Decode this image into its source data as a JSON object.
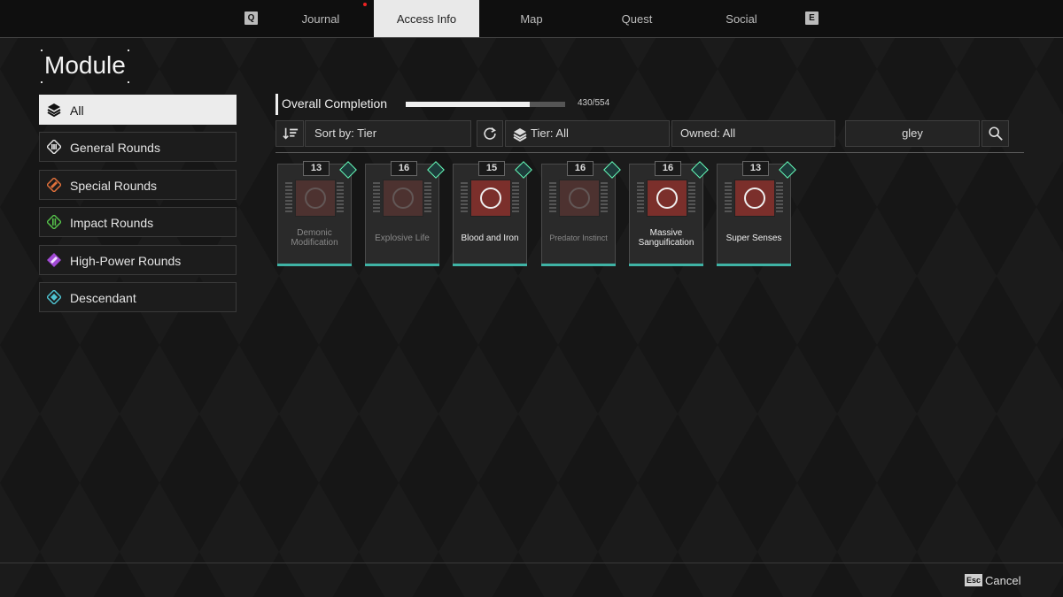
{
  "nav": {
    "left_key": "Q",
    "right_key": "E",
    "tabs": [
      {
        "label": "Journal"
      },
      {
        "label": "Access Info",
        "active": true
      },
      {
        "label": "Map"
      },
      {
        "label": "Quest"
      },
      {
        "label": "Social"
      }
    ]
  },
  "page_title": "Module",
  "sidebar": {
    "items": [
      {
        "label": "All",
        "icon": "layers-icon",
        "active": true
      },
      {
        "label": "General Rounds",
        "icon": "general-rounds-icon",
        "color": "#e6e6e6"
      },
      {
        "label": "Special Rounds",
        "icon": "special-rounds-icon",
        "color": "#e0703a"
      },
      {
        "label": "Impact Rounds",
        "icon": "impact-rounds-icon",
        "color": "#55c04a"
      },
      {
        "label": "High-Power Rounds",
        "icon": "high-power-rounds-icon",
        "color": "#a24ad6"
      },
      {
        "label": "Descendant",
        "icon": "descendant-icon",
        "color": "#4ec2d0"
      }
    ]
  },
  "completion": {
    "label": "Overall Completion",
    "count_text": "430/554",
    "current": 430,
    "total": 554
  },
  "filters": {
    "sort_label": "Sort by: Tier",
    "tier_label": "Tier: All",
    "owned_label": "Owned: All",
    "search_value": "gley"
  },
  "modules": [
    {
      "name": "Demonic Modification",
      "tier": "13",
      "owned": false
    },
    {
      "name": "Explosive Life",
      "tier": "16",
      "owned": false
    },
    {
      "name": "Blood and Iron",
      "tier": "15",
      "owned": true
    },
    {
      "name": "Predator Instinct",
      "tier": "16",
      "owned": false
    },
    {
      "name": "Massive Sanguification",
      "tier": "16",
      "owned": true
    },
    {
      "name": "Super Senses",
      "tier": "13",
      "owned": true
    }
  ],
  "footer": {
    "esc_key": "Esc",
    "cancel_label": "Cancel"
  }
}
